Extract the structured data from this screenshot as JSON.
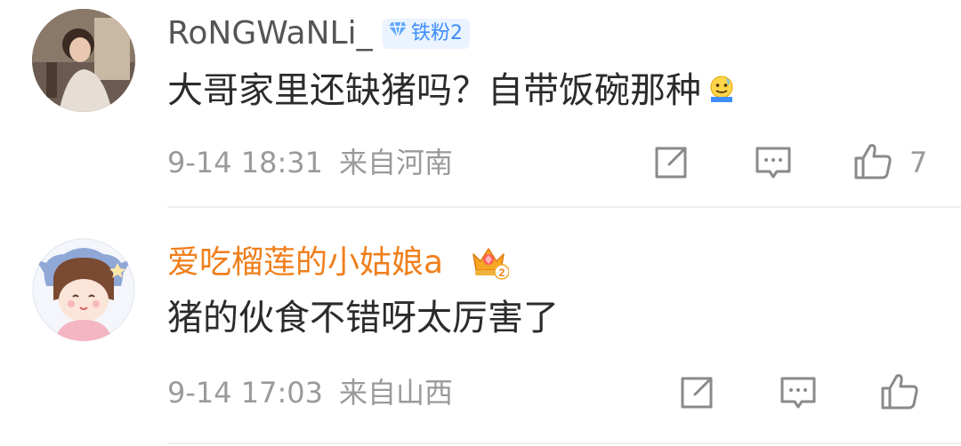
{
  "comments": [
    {
      "username": "RoNGWaNLi_",
      "username_color": "#555555",
      "badge": {
        "label": "铁粉2",
        "color": "#3d8dff"
      },
      "content": "大哥家里还缺猪吗？自带饭碗那种",
      "emoji": "cold-sweat-smile-emoji",
      "date": "9-14 18:31",
      "location": "来自河南",
      "like_count": "7"
    },
    {
      "username": "爱吃榴莲的小姑娘a",
      "username_color": "#f07f1c",
      "badge": {
        "label": "",
        "icon": "crown-level-2-icon",
        "color": "#f5a623"
      },
      "content": "猪的伙食不错呀太厉害了",
      "date": "9-14 17:03",
      "location": "来自山西",
      "like_count": ""
    }
  ],
  "icons": {
    "share": "share-square-icon",
    "comment": "comment-bubble-icon",
    "like": "thumbs-up-icon"
  }
}
